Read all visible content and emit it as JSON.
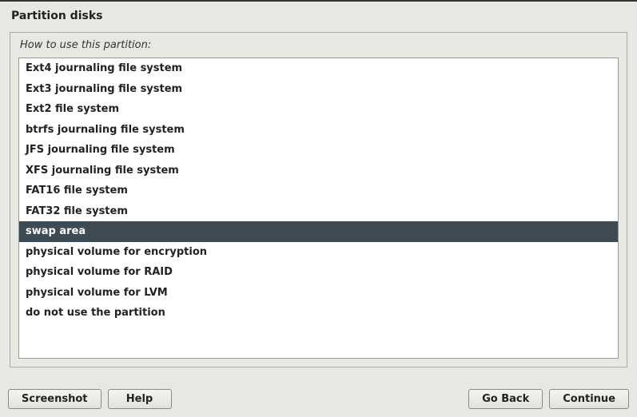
{
  "title": "Partition disks",
  "prompt": "How to use this partition:",
  "selected_index": 8,
  "options": [
    "Ext4 journaling file system",
    "Ext3 journaling file system",
    "Ext2 file system",
    "btrfs journaling file system",
    "JFS journaling file system",
    "XFS journaling file system",
    "FAT16 file system",
    "FAT32 file system",
    "swap area",
    "physical volume for encryption",
    "physical volume for RAID",
    "physical volume for LVM",
    "do not use the partition"
  ],
  "buttons": {
    "screenshot": "Screenshot",
    "help": "Help",
    "go_back": "Go Back",
    "continue": "Continue"
  }
}
